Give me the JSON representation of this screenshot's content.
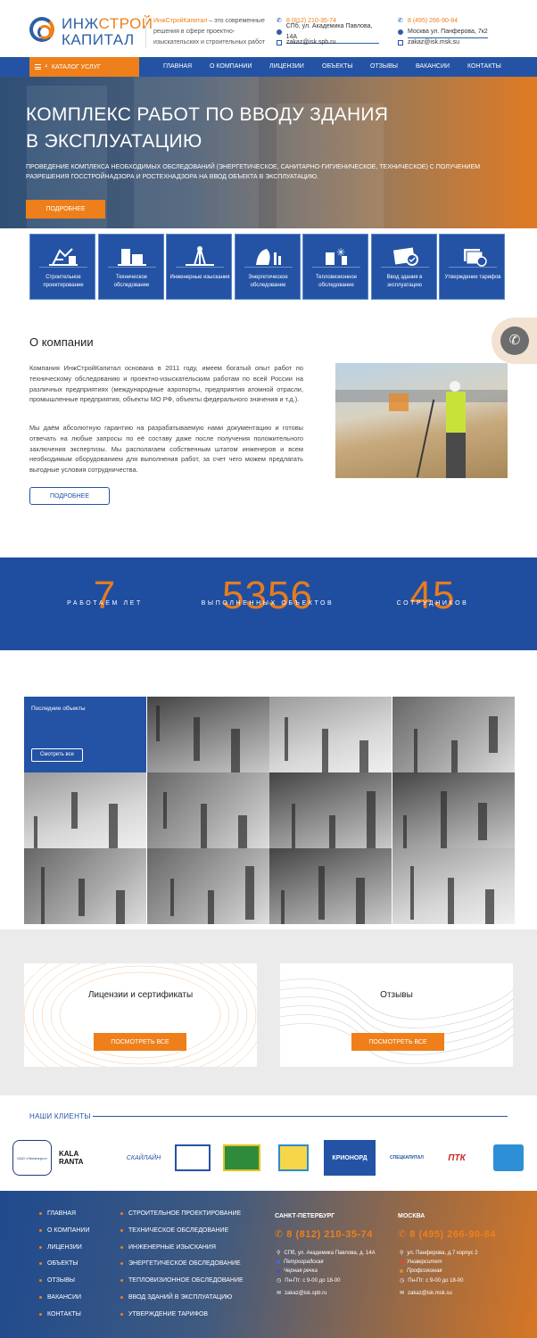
{
  "header": {
    "logo_line1_a": "ИНЖ",
    "logo_line1_b": "СТРОЙ",
    "logo_line2": "КАПИТАЛ",
    "tagline_brand": "ИнжСтройКапитал",
    "tagline_rest": " – это современные решения в сфере проектно-изыскательских и строительных работ",
    "spb": {
      "phone": "8 (812) 210-35-74",
      "address": "СПб, ул. Академика Павлова, 14А",
      "email": "zakaz@isk.spb.ru"
    },
    "msk": {
      "phone": "8 (495) 266-90-84",
      "address": "Москва ул. Панферова, 7к2",
      "email": "zakaz@isk.msk.su"
    }
  },
  "nav": {
    "catalog": "КАТАЛОГ УСЛУГ",
    "items": [
      "ГЛАВНАЯ",
      "О КОМПАНИИ",
      "ЛИЦЕНЗИИ",
      "ОБЪЕКТЫ",
      "ОТЗЫВЫ",
      "ВАКАНСИИ",
      "КОНТАКТЫ"
    ]
  },
  "hero": {
    "title": "КОМПЛЕКС РАБОТ ПО ВВОДУ ЗДАНИЯ В ЭКСПЛУАТАЦИЮ",
    "text": "ПРОВЕДЕНИЕ КОМПЛЕКСА НЕОБХОДИМЫХ ОБСЛЕДОВАНИЙ (ЭНЕРГЕТИЧЕСКОЕ, САНИТАРНО-ГИГИЕНИЧЕСКОЕ, ТЕХНИЧЕСКОЕ) С ПОЛУЧЕНИЕМ РАЗРЕШЕНИЯ ГОССТРОЙНАДЗОРА И РОСТЕХНАДЗОРА НА ВВОД ОБЪЕКТА В ЭКСПЛУАТАЦИЮ.",
    "button": "ПОДРОБНЕЕ"
  },
  "services": [
    {
      "label": "Строительное проектирование",
      "icon": "design-icon"
    },
    {
      "label": "Техническое обследование",
      "icon": "building-icon"
    },
    {
      "label": "Инженерные изыскания",
      "icon": "survey-icon"
    },
    {
      "label": "Энергетическое обследование",
      "icon": "energy-icon"
    },
    {
      "label": "Тепловизионное обследование",
      "icon": "thermal-icon"
    },
    {
      "label": "Ввод здания в эксплуатацию",
      "icon": "document-check-icon"
    },
    {
      "label": "Утверждение тарифов",
      "icon": "tariff-icon"
    }
  ],
  "about": {
    "title": "О компании",
    "p1": "Компания ИнжСтройКапитал основана в 2011 году, имеем богатый опыт работ по техническому обследованию и проектно-изыскательским работам по всей России на различных предприятиях (международные аэропорты, предприятия атомной отрасли, промышленные предприятия, объекты МО РФ, объекты федерального значения и т.д.).",
    "p2": "Мы даём абсолютную гарантию на разрабатываемую нами документацию и готовы отвечать на любые запросы по её составу даже после получения положительного заключения экспертизы. Мы располагаем собственным штатом инженеров и всем необходимым оборудованием для выполнения работ, за счет чего можем предлагать выгодные условия сотрудничества.",
    "button": "ПОДРОБНЕЕ"
  },
  "stats": [
    {
      "num": "7",
      "label": "РАБОТАЕМ ЛЕТ"
    },
    {
      "num": "5356",
      "label": "ВЫПОЛНЕННЫХ ОБЪЕКТОВ"
    },
    {
      "num": "45",
      "label": "СОТРУДНИКОВ"
    }
  ],
  "gallery": {
    "title": "Последние объекты",
    "button": "Смотреть все"
  },
  "cards": [
    {
      "title": "Лицензии и сертификаты",
      "button": "ПОСМОТРЕТЬ ВСЕ"
    },
    {
      "title": "Отзывы",
      "button": "ПОСМОТРЕТЬ ВСЕ"
    }
  ],
  "clients": {
    "title": "НАШИ КЛИЕНТЫ",
    "logos": [
      "ОАО «Ленэнерго»",
      "KALA RANTA",
      "СКАЙЛАЙН",
      "",
      "",
      "",
      "КРИОНОРД",
      "СПЕЦКАПИТАЛ",
      "ПТК",
      ""
    ]
  },
  "footer": {
    "menu": [
      "ГЛАВНАЯ",
      "О КОМПАНИИ",
      "ЛИЦЕНЗИИ",
      "ОБЪЕКТЫ",
      "ОТЗЫВЫ",
      "ВАКАНСИИ",
      "КОНТАКТЫ"
    ],
    "services": [
      "СТРОИТЕЛЬНОЕ ПРОЕКТИРОВАНИЕ",
      "ТЕХНИЧЕСКОЕ ОБСЛЕДОВАНИЕ",
      "ИНЖЕНЕРНЫЕ ИЗЫСКАНИЯ",
      "ЭНЕРГЕТИЧЕСКОЕ ОБСЛЕДОВАНИЕ",
      "ТЕПЛОВИЗИОННОЕ ОБСЛЕДОВАНИЕ",
      "ВВОД ЗДАНИЙ В ЭКСПЛУАТАЦИЮ",
      "УТВЕРЖДЕНИЕ ТАРИФОВ"
    ],
    "spb": {
      "city": "САНКТ-ПЕТЕРБУРГ",
      "phone": "8 (812) 210-35-74",
      "address": "СПб, ул. Академика Павлова, д. 14А",
      "metro1": "Петроградская",
      "metro2": "Черная речка",
      "hours": "Пн-Пт: с 9-00 до 18-00",
      "email": "zakaz@isk.spb.ru"
    },
    "msk": {
      "city": "МОСКВА",
      "phone": "8 (495) 266-90-84",
      "address": "ул. Панферова, д.7 корпус 2",
      "metro1": "Университет",
      "metro2": "Профсоюзная",
      "hours": "Пн-Пт: с 9-00 до 18-00",
      "email": "zakaz@isk.msk.su"
    }
  },
  "colors": {
    "blue": "#2453a5",
    "orange": "#ef7f1a"
  }
}
